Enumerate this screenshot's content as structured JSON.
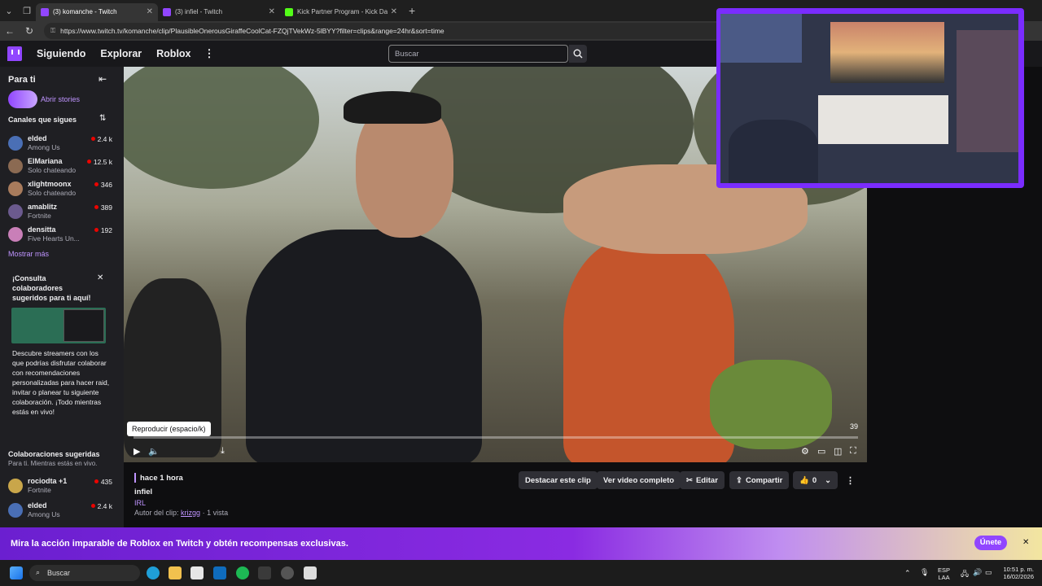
{
  "browser": {
    "tabs": [
      {
        "title": "(3) komanche - Twitch",
        "icon": "twitch-icon",
        "active": true
      },
      {
        "title": "(3) infiel - Twitch",
        "icon": "twitch-icon",
        "active": false
      },
      {
        "title": "Kick Partner Program - Kick Dashb",
        "icon": "kick-icon",
        "active": false
      }
    ],
    "url": "https://www.twitch.tv/komanche/clip/PlausibleOnerousGiraffeCoolCat-FZQjTVekWz-5lBYY?filter=clips&range=24hr&sort=time"
  },
  "topnav": {
    "links": [
      "Siguiendo",
      "Explorar",
      "Roblox"
    ],
    "search_placeholder": "Buscar"
  },
  "sidebar": {
    "title": "Para ti",
    "stories_label": "Abrir stories",
    "followed_title": "Canales que sigues",
    "channels": [
      {
        "name": "elded",
        "game": "Among Us",
        "viewers": "2.4 k",
        "color": "#4a6fb5"
      },
      {
        "name": "ElMariana",
        "game": "Solo chateando",
        "viewers": "12.5 k",
        "color": "#8b6a52"
      },
      {
        "name": "xlightmoonx",
        "game": "Solo chateando",
        "viewers": "346",
        "color": "#a87b5c"
      },
      {
        "name": "amablitz",
        "game": "Fortnite",
        "viewers": "389",
        "color": "#6b5a8e"
      },
      {
        "name": "densitta",
        "game": "Five Hearts Un...",
        "viewers": "192",
        "color": "#c97fb8"
      }
    ],
    "show_more": "Mostrar más",
    "promo": {
      "title": "¡Consulta colaboradores sugeridos para ti aquí!",
      "body": "Descubre streamers con los que podrías disfrutar colaborar con recomendaciones personalizadas para hacer raid, invitar o planear tu siguiente colaboración. ¡Todo mientras estás en vivo!"
    },
    "collab_title": "Colaboraciones sugeridas",
    "collab_sub": "Para ti. Mientras estás en vivo.",
    "collab_channels": [
      {
        "name": "rociodta +1",
        "game": "Fortnite",
        "viewers": "435",
        "color": "#c9a64a"
      },
      {
        "name": "elded",
        "game": "Among Us",
        "viewers": "2.4 k",
        "color": "#4a6fb5"
      }
    ]
  },
  "video": {
    "tooltip": "Reproducir (espacio/k)",
    "counter": "39"
  },
  "clip": {
    "time_ago": "hace 1 hora",
    "title": "infiel",
    "category": "IRL",
    "author_prefix": "Autor del clip:",
    "author": "krizgg",
    "views": "· 1 vista",
    "buttons": {
      "highlight": "Destacar este clip",
      "full_video": "Ver video completo",
      "edit": "Editar",
      "share": "Compartir",
      "likes": "0"
    }
  },
  "banner": {
    "text": "Mira la acción imparable de Roblox en Twitch y obtén recompensas exclusivas.",
    "join": "Únete"
  },
  "taskbar": {
    "search": "Buscar",
    "lang": "ESP",
    "region": "LAA",
    "time": "10:51 p. m.",
    "date": "16/02/2026"
  }
}
